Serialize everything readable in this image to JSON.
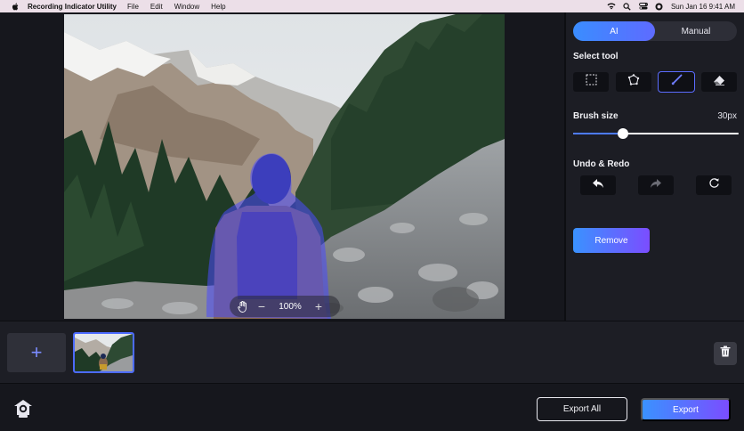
{
  "menubar": {
    "app_name": "Recording Indicator Utility",
    "menus": [
      "File",
      "Edit",
      "Window",
      "Help"
    ],
    "datetime": "Sun Jan 16  9:41 AM"
  },
  "canvas": {
    "zoom_label": "100%",
    "zoom_out": "−",
    "zoom_in": "+"
  },
  "panel": {
    "mode_tabs": [
      {
        "label": "AI",
        "active": true
      },
      {
        "label": "Manual",
        "active": false
      }
    ],
    "select_tool_title": "Select tool",
    "tools": [
      "rect-select",
      "lasso",
      "brush",
      "eraser"
    ],
    "active_tool": "brush",
    "brush_size_title": "Brush size",
    "brush_size_value": "30px",
    "brush_size_fraction": 0.3,
    "undo_redo_title": "Undo & Redo",
    "remove_label": "Remove"
  },
  "strip": {
    "add_symbol": "+"
  },
  "bottom": {
    "export_all_label": "Export All",
    "export_label": "Export"
  },
  "colors": {
    "accent_start": "#3a92ff",
    "accent_end": "#7b4dff",
    "mask": "#4b4bff"
  }
}
